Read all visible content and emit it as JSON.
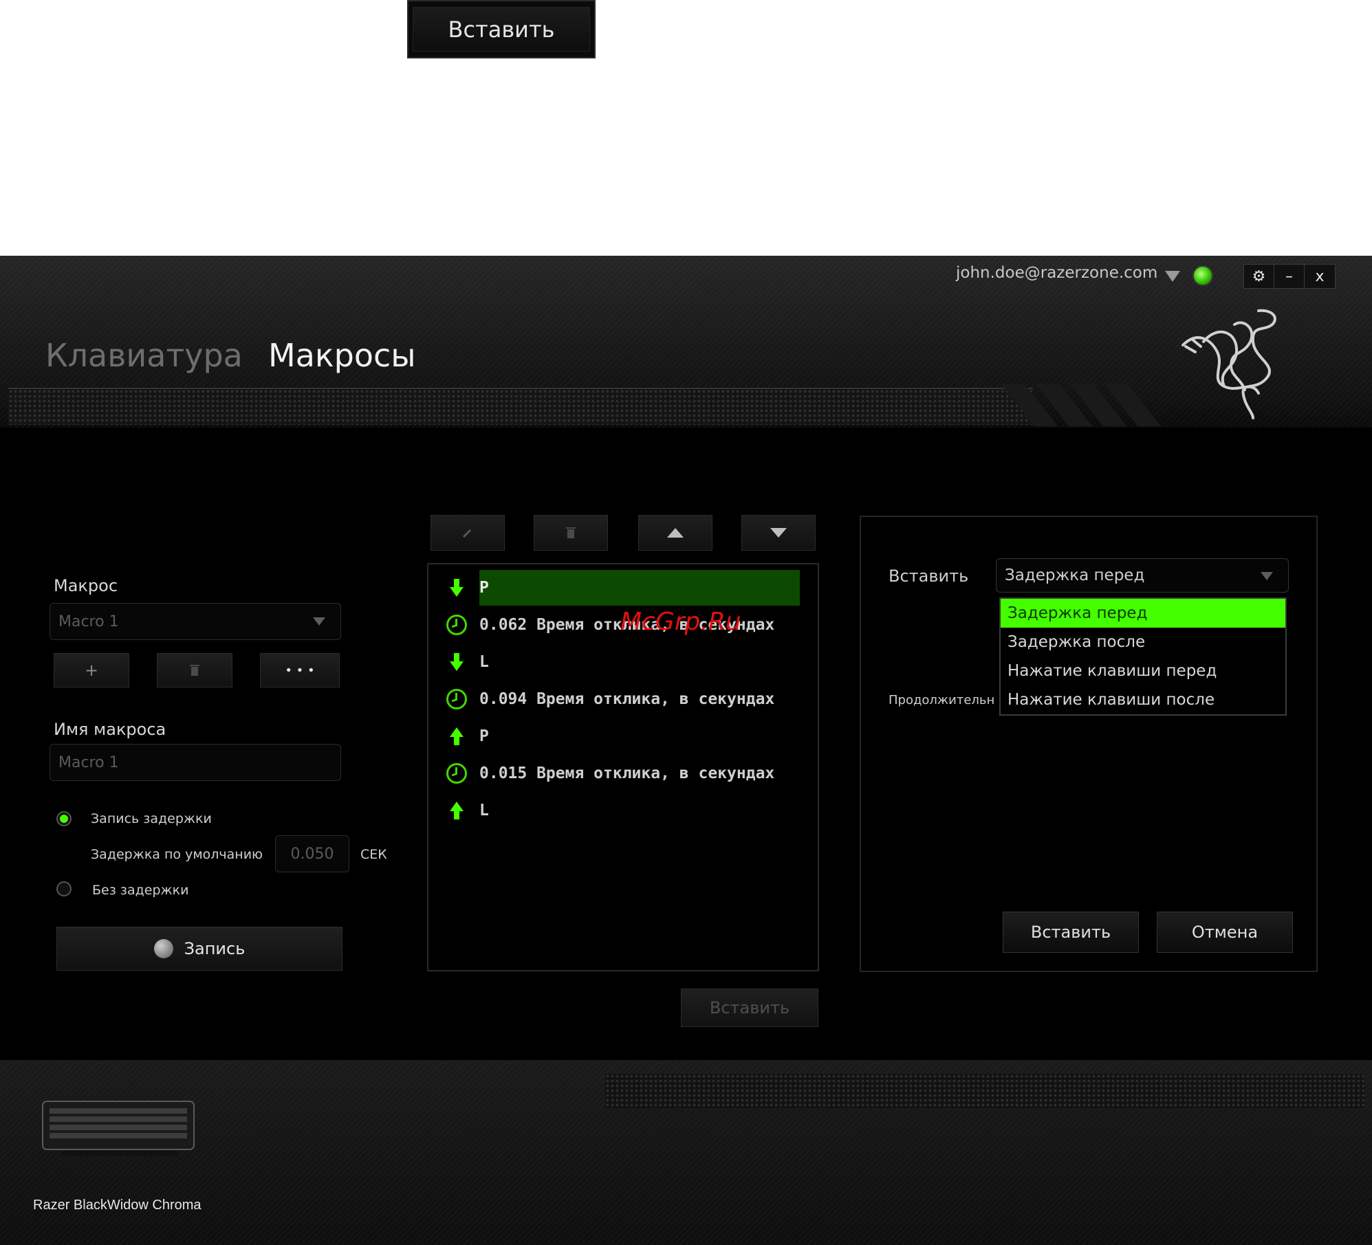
{
  "top_insert_button": {
    "label": "Вставить"
  },
  "header": {
    "user_email": "john.doe@razerzone.com",
    "window_controls": {
      "settings": "⚙",
      "minimize": "–",
      "close": "x"
    },
    "tabs": [
      {
        "label": "Клавиатура",
        "active": false
      },
      {
        "label": "Макросы",
        "active": true
      }
    ]
  },
  "left_panel": {
    "macro_label": "Макрос",
    "macro_select_value": "Macro 1",
    "macro_add": "+",
    "macro_more": "• • •",
    "name_label": "Имя макроса",
    "name_value": "Macro 1",
    "record_delay_label": "Запись задержки",
    "default_delay_label": "Задержка по умолчанию",
    "default_delay_value": "0.050",
    "default_delay_unit": "СЕК",
    "no_delay_label": "Без задержки",
    "record_button": "Запись"
  },
  "macro_list": {
    "rows": [
      {
        "icon": "arrow-down-icon",
        "text": "P",
        "selected": true
      },
      {
        "icon": "clock-icon",
        "text": "0.062 Время отклика, в секундах"
      },
      {
        "icon": "arrow-down-icon",
        "text": "L"
      },
      {
        "icon": "clock-icon",
        "text": "0.094 Время отклика, в секундах"
      },
      {
        "icon": "arrow-up-icon",
        "text": "P"
      },
      {
        "icon": "clock-icon",
        "text": "0.015 Время отклика, в секундах"
      },
      {
        "icon": "arrow-up-icon",
        "text": "L"
      }
    ],
    "insert_button": "Вставить"
  },
  "watermark": "McGrp.Ru",
  "insert_panel": {
    "insert_label": "Вставить",
    "selected_option": "Задержка перед",
    "options": [
      "Задержка перед",
      "Задержка после",
      "Нажатие клавиши перед",
      "Нажатие клавиши после"
    ],
    "duration_label": "Продолжительн",
    "insert_button": "Вставить",
    "cancel_button": "Отмена"
  },
  "footer": {
    "device_name": "Razer BlackWidow Chroma"
  },
  "colors": {
    "accent": "#44ff00",
    "selected_row": "#0b4a00",
    "watermark": "#e01010"
  }
}
